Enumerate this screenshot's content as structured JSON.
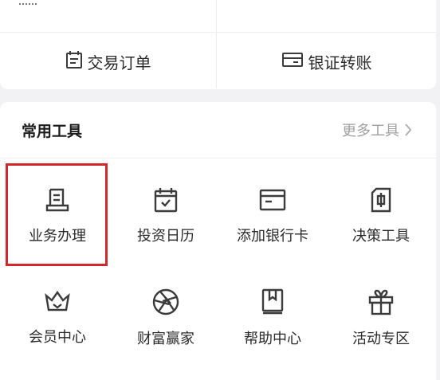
{
  "top_card": {
    "buttons": [
      {
        "label": "交易订单",
        "icon": "calendar-doc-icon"
      },
      {
        "label": "银证转账",
        "icon": "card-transfer-icon"
      }
    ]
  },
  "tools": {
    "title": "常用工具",
    "more_label": "更多工具",
    "items": [
      {
        "label": "业务办理",
        "icon": "printer-doc-icon",
        "highlighted": true
      },
      {
        "label": "投资日历",
        "icon": "calendar-check-icon"
      },
      {
        "label": "添加银行卡",
        "icon": "bank-card-icon"
      },
      {
        "label": "决策工具",
        "icon": "tool-box-icon"
      },
      {
        "label": "会员中心",
        "icon": "crown-icon"
      },
      {
        "label": "财富赢家",
        "icon": "aperture-icon"
      },
      {
        "label": "帮助中心",
        "icon": "book-icon"
      },
      {
        "label": "活动专区",
        "icon": "gift-icon"
      }
    ]
  },
  "colors": {
    "highlight": "#d0282d",
    "icon": "#3b3b3b",
    "muted": "#a0a0a0"
  }
}
